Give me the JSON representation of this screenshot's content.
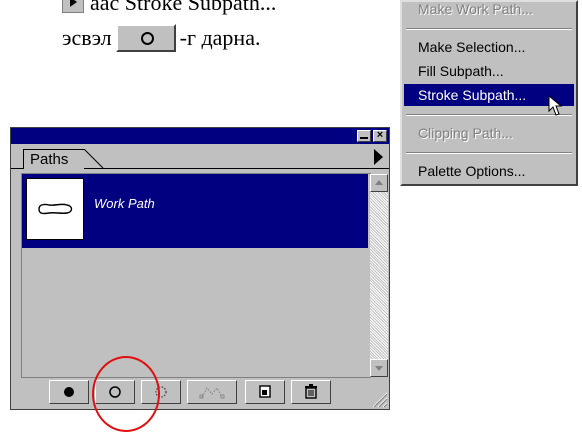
{
  "document": {
    "line1_text": "аас Stroke Subpath...",
    "line2_text_before": "эсвэл",
    "line2_text_after": "-г дарна."
  },
  "context_menu": {
    "items": [
      {
        "label": "Make Work Path...",
        "state": "disabled"
      },
      {
        "label": "Make Selection...",
        "state": "normal"
      },
      {
        "label": "Fill Subpath...",
        "state": "normal"
      },
      {
        "label": "Stroke Subpath...",
        "state": "selected"
      },
      {
        "label": "Clipping Path...",
        "state": "disabled"
      },
      {
        "label": "Palette Options...",
        "state": "normal"
      }
    ]
  },
  "palette": {
    "tab_label": "Paths",
    "paths": [
      {
        "name": "Work Path",
        "selected": true
      }
    ],
    "bottom_buttons": [
      {
        "icon": "fill-path-icon"
      },
      {
        "icon": "stroke-path-icon"
      },
      {
        "icon": "load-selection-icon"
      },
      {
        "icon": "make-work-path-icon"
      },
      {
        "icon": "new-path-icon"
      },
      {
        "icon": "trash-icon"
      }
    ]
  },
  "colors": {
    "selection": "#000080",
    "panel": "#c0c0c0",
    "highlight_circle": "#e01010"
  }
}
